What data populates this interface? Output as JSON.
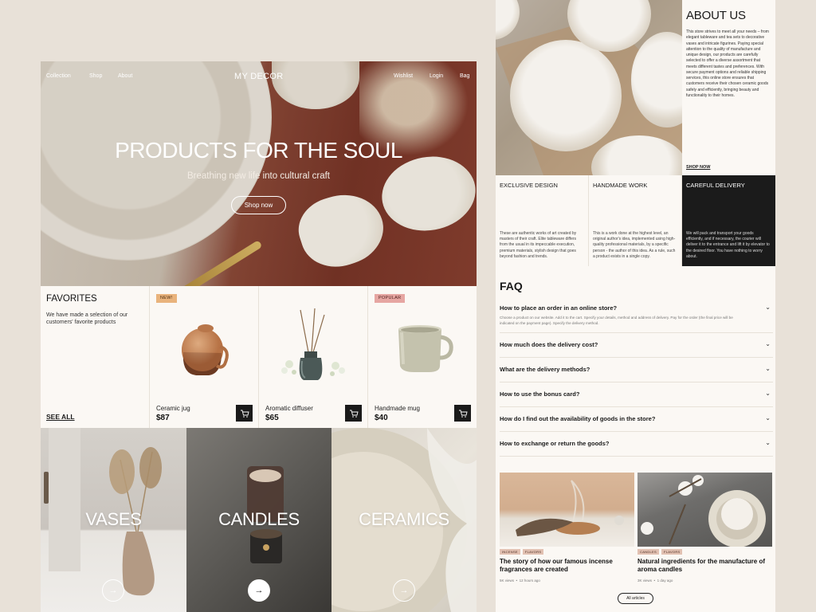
{
  "nav": {
    "collection": "Collection",
    "shop": "Shop",
    "about": "About",
    "logo": "MY DECOR",
    "wishlist": "Wishlist",
    "login": "Login",
    "bag": "Bag"
  },
  "hero": {
    "title": "PRODUCTS FOR THE SOUL",
    "subtitle": "Breathing new life into cultural craft",
    "button": "Shop now"
  },
  "favorites": {
    "title": "FAVORITES",
    "description": "We have made a selection of our customers' favorite products",
    "see_all": "SEE ALL",
    "products": [
      {
        "badge": "NEW!",
        "name": "Ceramic jug",
        "price": "$87",
        "icon": "jug-image"
      },
      {
        "badge": "",
        "name": "Aromatic diffuser",
        "price": "$65",
        "icon": "diffuser-image"
      },
      {
        "badge": "POPULAR",
        "name": "Handmade mug",
        "price": "$40",
        "icon": "mug-image"
      }
    ]
  },
  "categories": [
    {
      "label": "VASES"
    },
    {
      "label": "CANDLES"
    },
    {
      "label": "CERAMICS"
    }
  ],
  "about": {
    "title": "ABOUT US",
    "body": "This store strives to meet all your needs – from elegant tableware and tea sets to decorative vases and intricate figurines. Paying special attention to the quality of manufacture and unique design, our products are carefully selected to offer a diverse assortment that meets different tastes and preferences. With secure payment options and reliable shipping services, this online store ensures that customers receive their chosen ceramic goods safely and efficiently, bringing beauty and functionality to their homes.",
    "shop_now": "SHOP NOW"
  },
  "features": [
    {
      "title": "EXCLUSIVE DESIGN",
      "text": "These are authentic works of art created by masters of their craft. Elite tableware differs from the usual in its impeccable execution, premium materials, stylish design that goes beyond fashion and trends."
    },
    {
      "title": "HANDMADE WORK",
      "text": "This is a work done at the highest level, an original author's idea, implemented using high-quality professional materials, by a specific person - the author of this idea. As a rule, such a product exists in a single copy."
    },
    {
      "title": "CAREFUL DELIVERY",
      "text": "We will pack and transport your goods efficiently, and if necessary, the courier will deliver it to the entrance and lift it by elevator to the desired floor. You have nothing to worry about."
    }
  ],
  "faq": {
    "title": "FAQ",
    "items": [
      {
        "q": "How to place an order in an online store?",
        "a": "Choose a product on our website. Add it to the cart. Specify your details, method and address of delivery. Pay for the order (the final price will be indicated on the payment page). Specify the delivery method."
      },
      {
        "q": "How much does the delivery cost?",
        "a": ""
      },
      {
        "q": "What are the delivery methods?",
        "a": ""
      },
      {
        "q": "How to use the bonus card?",
        "a": ""
      },
      {
        "q": "How do I find out the availability of goods in the store?",
        "a": ""
      },
      {
        "q": "How to exchange or return the goods?",
        "a": ""
      }
    ]
  },
  "articles": {
    "items": [
      {
        "tags": [
          "INCENSE",
          "FLAVORS"
        ],
        "title": "The story of how our famous incense fragrances are created",
        "views": "5K views",
        "time": "12 hours ago"
      },
      {
        "tags": [
          "CANDLES",
          "FLAVORS"
        ],
        "title": "Natural ingredients for the manufacture of aroma candles",
        "views": "3K views",
        "time": "1 day ago"
      }
    ],
    "all_button": "All articles"
  },
  "colors": {
    "background": "#e8e1d8",
    "page": "#fbf8f4",
    "dark_panel": "#1b1b1b",
    "badge_new": "#e9b37c",
    "badge_popular": "#e6a6a2",
    "hero_cloth": "#7a3628"
  }
}
